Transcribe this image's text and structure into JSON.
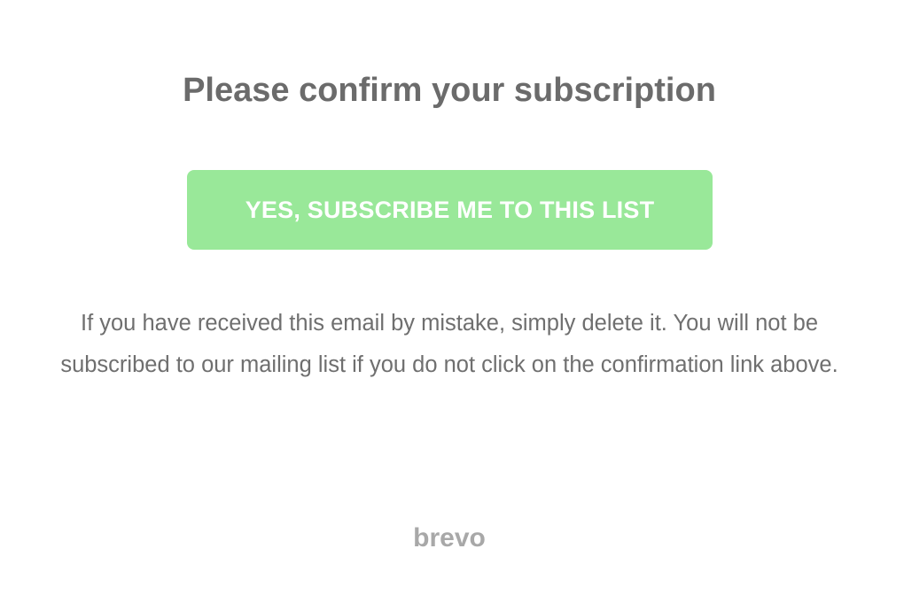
{
  "confirmation": {
    "title": "Please confirm your subscription",
    "button_label": "YES, SUBSCRIBE ME TO THIS LIST",
    "message_line_1": "If you have received this email by mistake, simply delete it. You will not be",
    "message_line_2": "subscribed to our mailing list if you do not click on the confirmation link above."
  },
  "footer": {
    "brand": "brevo"
  },
  "colors": {
    "button_background": "#99e899",
    "button_text": "#ffffff",
    "title_text": "#6b6b6b",
    "body_text": "#6f6f6f",
    "brand_text": "#a8a8a8"
  }
}
